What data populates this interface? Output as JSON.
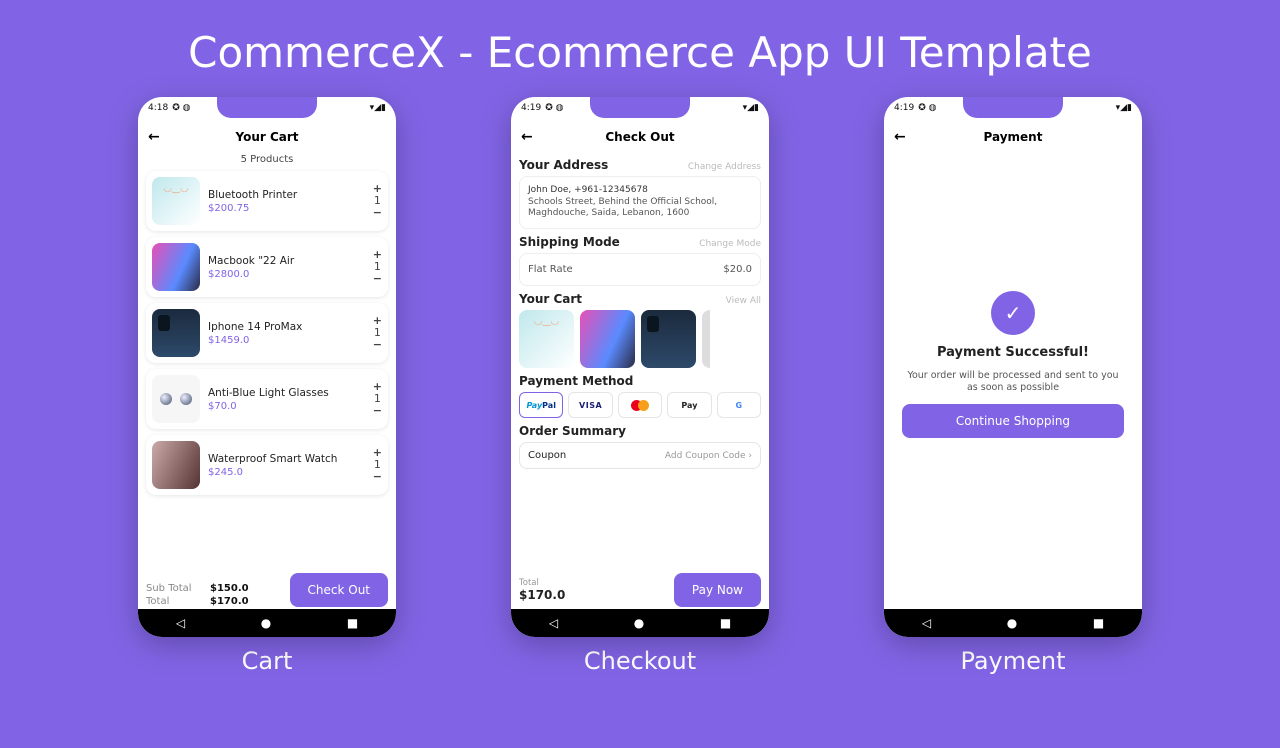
{
  "mainTitle": "CommerceX - Ecommerce App UI Template",
  "captions": {
    "cart": "Cart",
    "checkout": "Checkout",
    "payment": "Payment"
  },
  "colors": {
    "accent": "#8164e5"
  },
  "statusBar": {
    "leftTime": [
      "4:18",
      "4:19",
      "4:19"
    ]
  },
  "cart": {
    "title": "Your Cart",
    "countLabel": "5 Products",
    "items": [
      {
        "name": "Bluetooth Printer",
        "price": "$200.75",
        "qty": "1",
        "thumbClass": "printer"
      },
      {
        "name": "Macbook \"22 Air",
        "price": "$2800.0",
        "qty": "1",
        "thumbClass": "macbook"
      },
      {
        "name": "Iphone 14 ProMax",
        "price": "$1459.0",
        "qty": "1",
        "thumbClass": "iphone"
      },
      {
        "name": "Anti-Blue Light Glasses",
        "price": "$70.0",
        "qty": "1",
        "thumbClass": "glasses"
      },
      {
        "name": "Waterproof Smart Watch",
        "price": "$245.0",
        "qty": "1",
        "thumbClass": "watch"
      }
    ],
    "subTotalLabel": "Sub Total",
    "subTotal": "$150.0",
    "totalLabel": "Total",
    "total": "$170.0",
    "checkoutBtn": "Check Out"
  },
  "checkout": {
    "title": "Check Out",
    "address": {
      "heading": "Your Address",
      "action": "Change Address",
      "name": "John Doe, +961-12345678",
      "line1": "Schools Street, Behind the Official School,",
      "line2": "Maghdouche, Saida, Lebanon, 1600"
    },
    "shipping": {
      "heading": "Shipping Mode",
      "action": "Change Mode",
      "mode": "Flat Rate",
      "price": "$20.0"
    },
    "yourCart": {
      "heading": "Your Cart",
      "action": "View All"
    },
    "paymentMethod": {
      "heading": "Payment Method",
      "options": [
        "PayPal",
        "VISA",
        "mastercard",
        "Apple Pay",
        "Google"
      ]
    },
    "orderSummary": "Order Summary",
    "coupon": {
      "label": "Coupon",
      "action": "Add Coupon Code"
    },
    "totalLabel": "Total",
    "total": "$170.0",
    "payNow": "Pay Now"
  },
  "payment": {
    "title": "Payment",
    "successTitle": "Payment Successful!",
    "message": "Your order will be processed and sent to you as soon as possible",
    "continueBtn": "Continue Shopping"
  }
}
